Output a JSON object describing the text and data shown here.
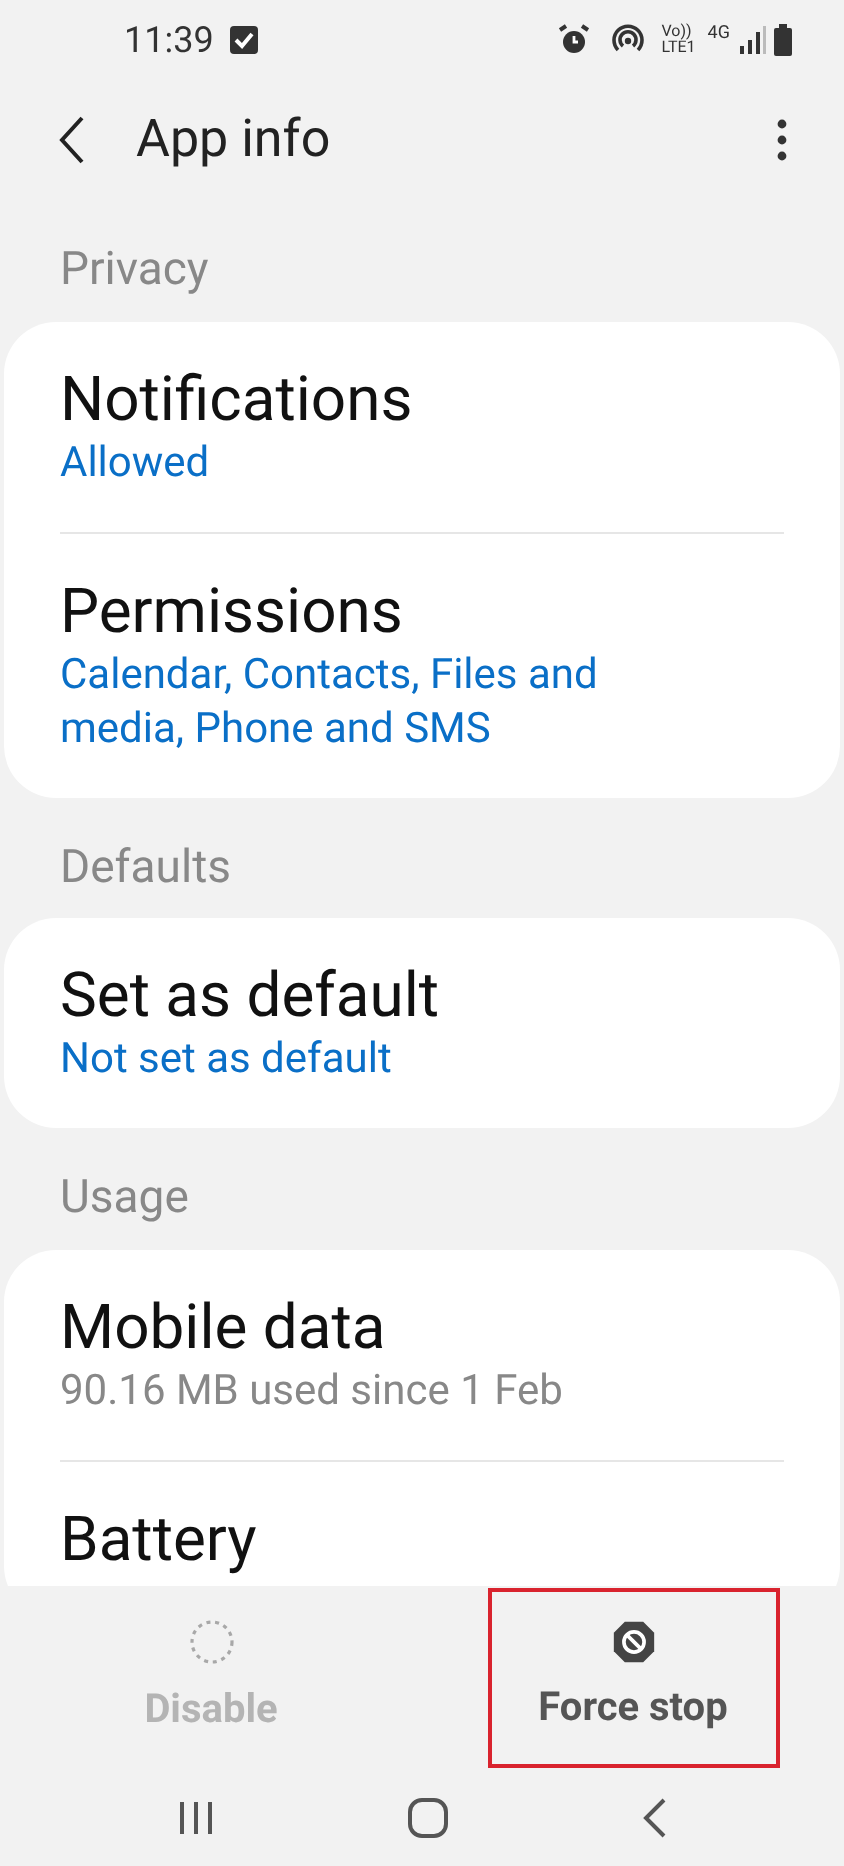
{
  "status_bar": {
    "time": "11:39",
    "volte": "Vo))",
    "lte": "LTE1",
    "network": "4G"
  },
  "header": {
    "title": "App info"
  },
  "sections": [
    {
      "heading": "Privacy",
      "items": [
        {
          "title": "Notifications",
          "subtitle": "Allowed",
          "kind": "link"
        },
        {
          "title": "Permissions",
          "subtitle": "Calendar, Contacts, Files and media, Phone and SMS",
          "kind": "link"
        }
      ]
    },
    {
      "heading": "Defaults",
      "items": [
        {
          "title": "Set as default",
          "subtitle": "Not set as default",
          "kind": "link"
        }
      ]
    },
    {
      "heading": "Usage",
      "items": [
        {
          "title": "Mobile data",
          "subtitle": "90.16 MB used since 1 Feb",
          "kind": "info"
        },
        {
          "title": "Battery",
          "kind": "plain"
        }
      ]
    }
  ],
  "actions": [
    {
      "label": "Disable",
      "kind": "disable",
      "disabled": true,
      "highlighted": false
    },
    {
      "label": "Force stop",
      "kind": "stop",
      "disabled": false,
      "highlighted": true
    }
  ]
}
